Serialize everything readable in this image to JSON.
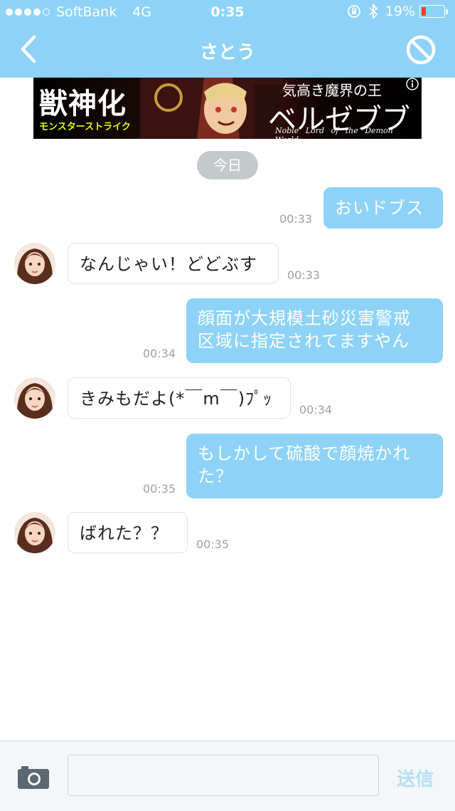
{
  "status_bar": {
    "carrier": "SoftBank",
    "network": "4G",
    "time": "0:35",
    "battery_percent": "19%",
    "battery_level": 0.19
  },
  "header": {
    "title": "さとう",
    "back_icon": "chevron-left-icon",
    "block_icon": "block-icon"
  },
  "banner": {
    "left_title": "獣神化",
    "game_name": "モンスターストライク",
    "subtitle": "気高き魔界の王",
    "character_name": "ベルゼブブ",
    "english": "Noble Lord of the Demon World"
  },
  "date_divider": "今日",
  "messages": [
    {
      "dir": "out",
      "lines": [
        "おいドブス"
      ],
      "time": "00:33"
    },
    {
      "dir": "in",
      "lines": [
        "なんじゃい！どどぶす"
      ],
      "time": "00:33"
    },
    {
      "dir": "out",
      "lines": [
        "顔面が大規模土砂災害警戒",
        "区域に指定されてますやん"
      ],
      "time": "00:34"
    },
    {
      "dir": "in",
      "lines": [
        "きみもだよ(*￣m￣)ﾌﾟｯ"
      ],
      "time": "00:34"
    },
    {
      "dir": "out",
      "lines": [
        "もしかして硫酸で顔焼かれ",
        "た？"
      ],
      "time": "00:35"
    },
    {
      "dir": "in",
      "lines": [
        "ばれた？？"
      ],
      "time": "00:35"
    }
  ],
  "footer": {
    "camera_icon": "camera-icon",
    "input_value": "",
    "input_placeholder": "",
    "send_label": "送信"
  },
  "colors": {
    "header_bg": "#8ed3f7",
    "outgoing_bubble": "#8ed3f7",
    "send_disabled": "#b5dff6"
  }
}
